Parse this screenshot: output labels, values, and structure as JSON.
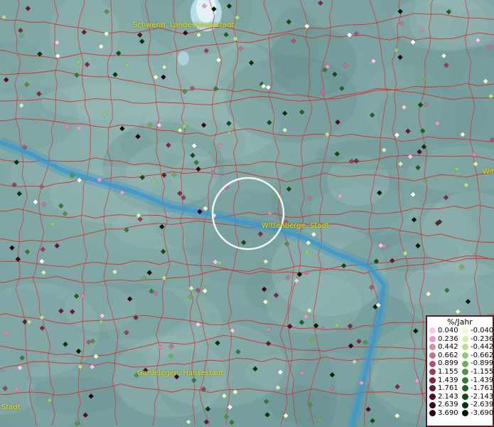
{
  "map": {
    "labels": [
      {
        "name": "schwerin",
        "text": "Schwerin, Landeshauptstadt"
      },
      {
        "name": "wittenberge",
        "text": "Wittenberge, Stadt"
      },
      {
        "name": "gardelegen",
        "text": "Gardelegen, Hansestadt"
      },
      {
        "name": "partial-left",
        "text": "Stadt"
      },
      {
        "name": "partial-right",
        "text": "Wit"
      }
    ],
    "colors": {
      "water": "#3d97c9",
      "borders": "#d23030",
      "label": "#e6e600",
      "focus_ring": "#ffffff"
    }
  },
  "legend": {
    "title": "%/Jahr",
    "positive": [
      {
        "value": "0.040",
        "color": "#f8c6ef"
      },
      {
        "value": "0.236",
        "color": "#e89ccc"
      },
      {
        "value": "0.442",
        "color": "#d68aae"
      },
      {
        "value": "0.662",
        "color": "#c27295"
      },
      {
        "value": "0.899",
        "color": "#a95676"
      },
      {
        "value": "1.155",
        "color": "#93405e"
      },
      {
        "value": "1.439",
        "color": "#7c2a47"
      },
      {
        "value": "1.761",
        "color": "#681a33"
      },
      {
        "value": "2.143",
        "color": "#520d22"
      },
      {
        "value": "2.639",
        "color": "#3d0615"
      },
      {
        "value": "3.690",
        "color": "#22020a"
      }
    ],
    "negative": [
      {
        "value": "-0.040",
        "color": "#f2fad0"
      },
      {
        "value": "-0.236",
        "color": "#d7efae"
      },
      {
        "value": "-0.442",
        "color": "#b7df8e"
      },
      {
        "value": "-0.662",
        "color": "#93c974"
      },
      {
        "value": "-0.899",
        "color": "#6fae5c"
      },
      {
        "value": "-1.155",
        "color": "#4f9445"
      },
      {
        "value": "-1.439",
        "color": "#357a33"
      },
      {
        "value": "-1.761",
        "color": "#206321"
      },
      {
        "value": "-2.143",
        "color": "#114c14"
      },
      {
        "value": "-2.639",
        "color": "#073509"
      },
      {
        "value": "-3.690",
        "color": "#011a02"
      }
    ]
  }
}
